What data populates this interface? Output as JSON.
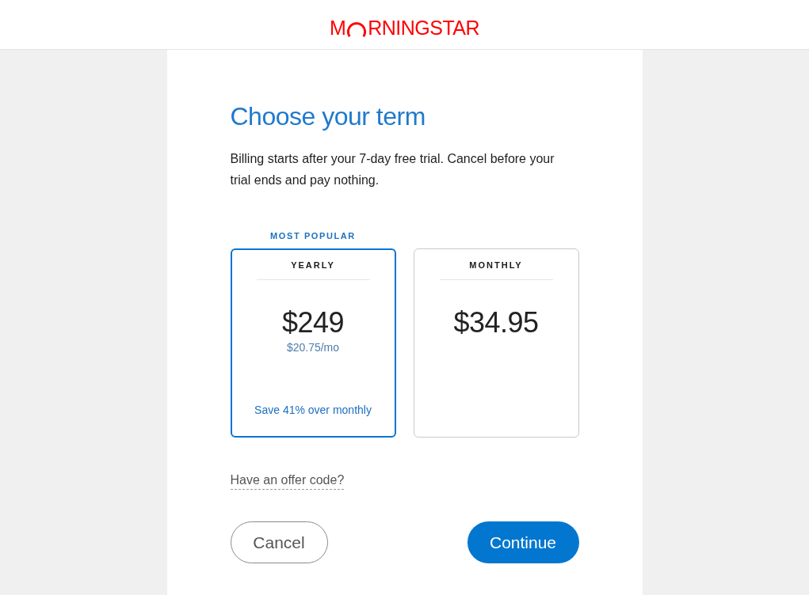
{
  "header": {
    "logo": {
      "text_before": "M",
      "text_after": "RNINGSTAR"
    }
  },
  "heading": "Choose your term",
  "description": "Billing starts after your 7-day free trial. Cancel before your trial ends and pay nothing.",
  "plans": [
    {
      "badge": "MOST POPULAR",
      "name": "YEARLY",
      "price": "$249",
      "per_month": "$20.75/mo",
      "savings": "Save 41% over monthly",
      "selected": true
    },
    {
      "name": "MONTHLY",
      "price": "$34.95",
      "selected": false
    }
  ],
  "offer_link": "Have an offer code?",
  "buttons": [
    {
      "label": "Cancel",
      "kind": "secondary"
    },
    {
      "label": "Continue",
      "kind": "primary"
    }
  ]
}
